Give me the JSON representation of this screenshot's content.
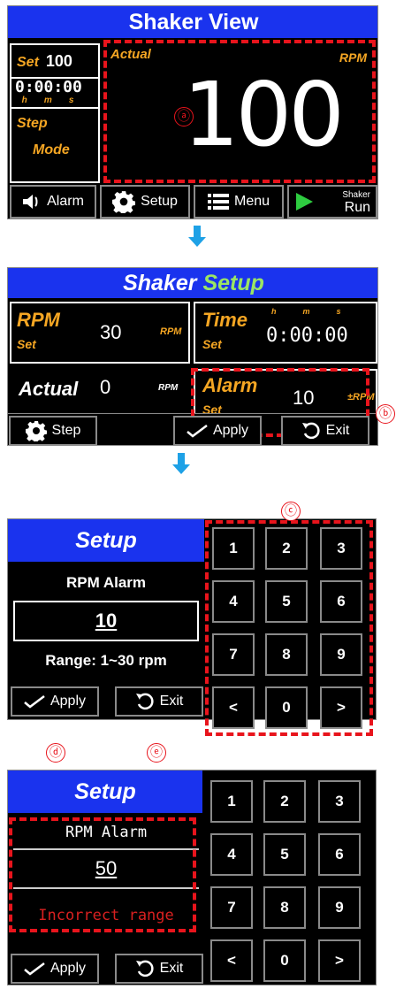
{
  "screen1": {
    "title": "Shaker View",
    "set_label": "Set",
    "set_value": "100",
    "timer": "0:00:00",
    "timer_units": [
      "h",
      "m",
      "s"
    ],
    "step_label": "Step",
    "mode_label": "Mode",
    "actual_label": "Actual",
    "rpm_label": "RPM",
    "actual_value": "100",
    "marker": "ⓐ",
    "buttons": {
      "alarm": "Alarm",
      "setup": "Setup",
      "menu": "Menu",
      "run_top": "Shaker",
      "run_bottom": "Run"
    }
  },
  "screen2": {
    "title_a": "Shaker",
    "title_b": "Setup",
    "rpm_label": "RPM",
    "rpm_set": "Set",
    "rpm_value": "30",
    "rpm_unit": "RPM",
    "time_label": "Time",
    "time_set": "Set",
    "time_units": [
      "h",
      "m",
      "s"
    ],
    "time_value": "0:00:00",
    "actual_label": "Actual",
    "actual_value": "0",
    "actual_unit": "RPM",
    "alarm_label": "Alarm",
    "alarm_set": "Set",
    "alarm_value": "10",
    "alarm_unit": "±RPM",
    "marker": "ⓑ",
    "buttons": {
      "step": "Step",
      "apply": "Apply",
      "exit": "Exit"
    }
  },
  "screen3": {
    "title": "Setup",
    "heading": "RPM Alarm",
    "value": "10",
    "range": "Range: 1~30 rpm",
    "keys": [
      "1",
      "2",
      "3",
      "4",
      "5",
      "6",
      "7",
      "8",
      "9",
      "<",
      "0",
      ">"
    ],
    "marker_keypad": "ⓒ",
    "marker_apply": "ⓓ",
    "marker_exit": "ⓔ",
    "buttons": {
      "apply": "Apply",
      "exit": "Exit"
    }
  },
  "screen4": {
    "title": "Setup",
    "heading": "RPM Alarm",
    "value": "50",
    "error": "Incorrect range",
    "keys": [
      "1",
      "2",
      "3",
      "4",
      "5",
      "6",
      "7",
      "8",
      "9",
      "<",
      "0",
      ">"
    ],
    "buttons": {
      "apply": "Apply",
      "exit": "Exit"
    }
  },
  "colors": {
    "title_bar": "#1a33ee",
    "accent_yellow": "#f5a623",
    "highlight_red": "#e8141c",
    "arrow_blue": "#1ea1e6",
    "run_green": "#2ecc40",
    "title_green": "#9be564"
  }
}
